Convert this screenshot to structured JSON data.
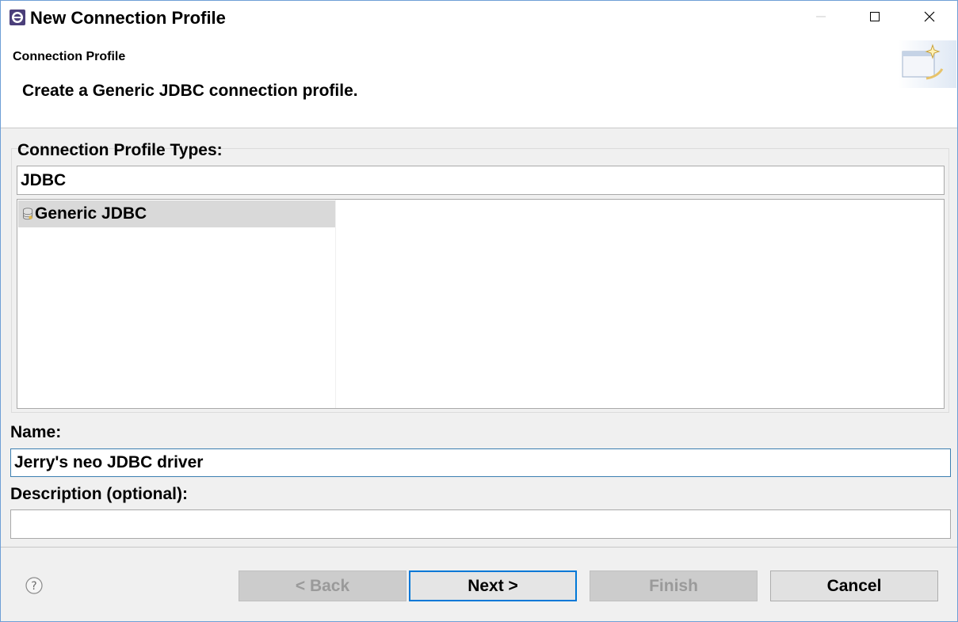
{
  "window": {
    "title": "New Connection Profile",
    "controls": [
      "minimize",
      "maximize",
      "close"
    ]
  },
  "banner": {
    "title": "Connection Profile",
    "description": "Create a Generic JDBC connection profile."
  },
  "profile_types": {
    "label": "Connection Profile Types:",
    "filter_value": "JDBC",
    "items": [
      {
        "label": "Generic JDBC",
        "icon": "database-icon",
        "selected": true
      }
    ]
  },
  "name": {
    "label": "Name:",
    "value": "Jerry's neo JDBC driver"
  },
  "description": {
    "label": "Description (optional):",
    "value": ""
  },
  "buttons": {
    "back": "< Back",
    "next": "Next >",
    "finish": "Finish",
    "cancel": "Cancel"
  },
  "colors": {
    "focus_border": "#0078d7",
    "selection": "#d9d9d9",
    "disabled_text": "#9a9a9a"
  }
}
